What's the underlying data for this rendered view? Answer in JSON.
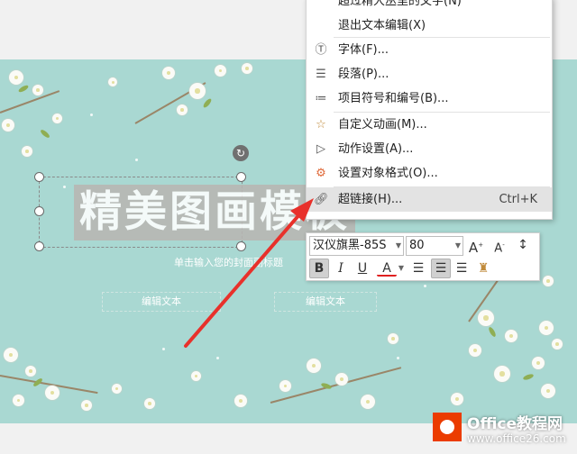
{
  "slide": {
    "title": "精美图画模板",
    "subtitle": "单击输入您的封面副标题",
    "edit_box_left": "编辑文本",
    "edit_box_right": "编辑文本"
  },
  "context_menu": {
    "items": [
      {
        "label": "超过精大丛里的文字(N)",
        "icon": ""
      },
      {
        "label": "退出文本编辑(X)",
        "icon": ""
      },
      {
        "label": "字体(F)...",
        "icon": "font-icon"
      },
      {
        "label": "段落(P)...",
        "icon": "paragraph-icon"
      },
      {
        "label": "项目符号和编号(B)...",
        "icon": "bullet-list-icon"
      },
      {
        "label": "自定义动画(M)...",
        "icon": "custom-animation-icon"
      },
      {
        "label": "动作设置(A)...",
        "icon": "action-settings-icon"
      },
      {
        "label": "设置对象格式(O)...",
        "icon": "format-object-icon"
      },
      {
        "label": "超链接(H)...",
        "icon": "hyperlink-icon",
        "shortcut": "Ctrl+K",
        "highlighted": true
      }
    ]
  },
  "mini_toolbar": {
    "font_name": "汉仪旗黑-85S",
    "font_size": "80",
    "grow_font": "A",
    "shrink_font": "A",
    "bold": "B",
    "italic": "I",
    "underline": "U",
    "font_color": "A",
    "font_color_hex": "#e02020"
  },
  "watermark": {
    "brand": "Office教程网",
    "url": "www.office26.com",
    "accent": "#eb3c00"
  },
  "colors": {
    "slide_bg": "#a9d8d2",
    "arrow": "#e8312b"
  }
}
